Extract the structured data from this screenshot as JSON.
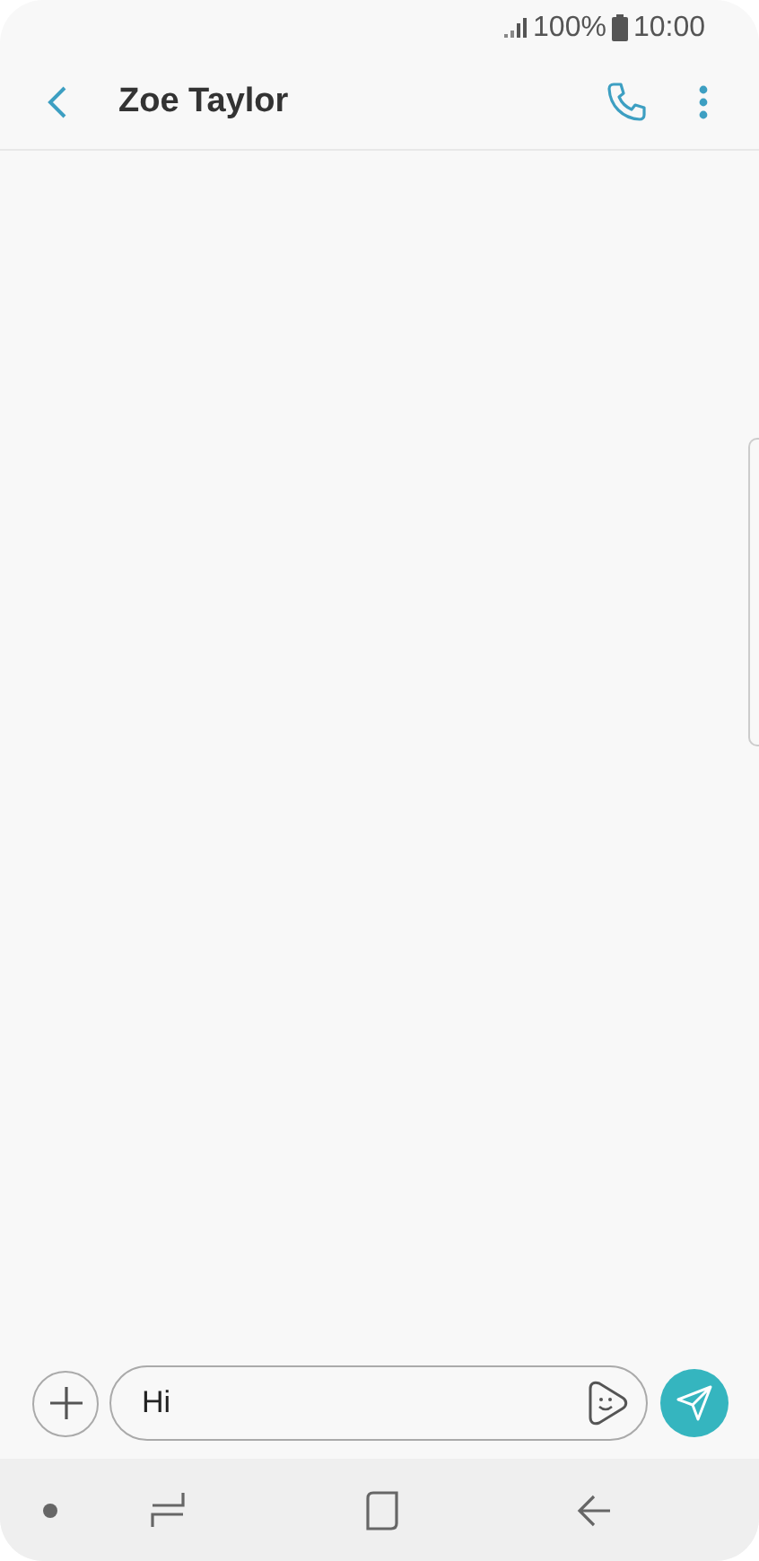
{
  "status_bar": {
    "battery": "100%",
    "time": "10:00"
  },
  "header": {
    "title": "Zoe Taylor"
  },
  "composer": {
    "value": "Hi"
  }
}
